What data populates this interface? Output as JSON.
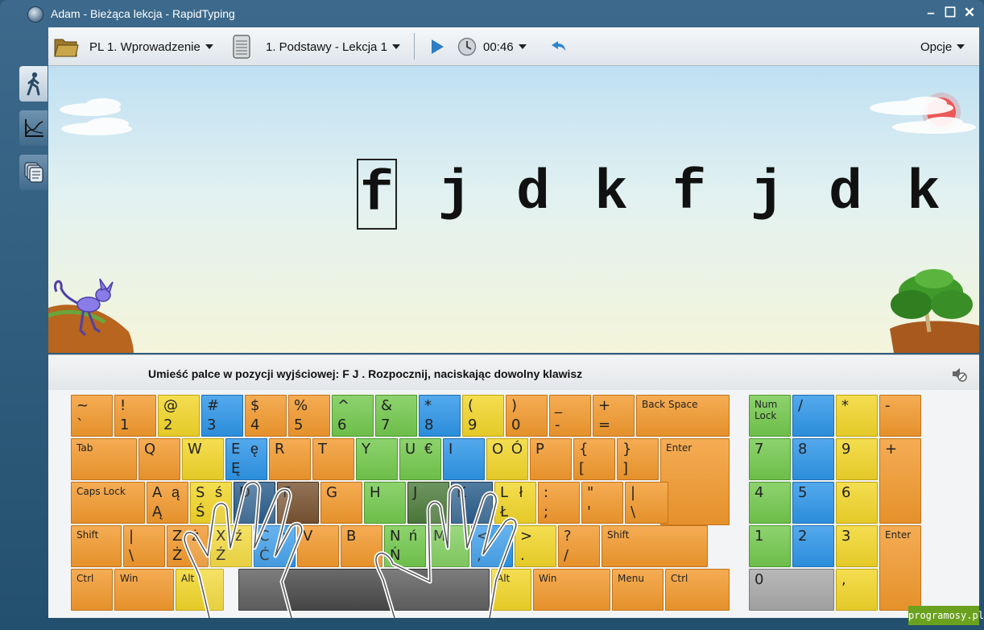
{
  "window": {
    "title": "Adam - Bieżąca lekcja - RapidTyping",
    "minimize": "–",
    "maximize": "☐",
    "close": "✕"
  },
  "toolbar": {
    "course": "PL 1. Wprowadzenie",
    "lesson": "1. Podstawy - Lekcja 1",
    "timer": "00:46",
    "options": "Opcje"
  },
  "sidebar": {
    "items": [
      {
        "name": "lesson-icon",
        "active": true
      },
      {
        "name": "statistics-icon",
        "active": false
      },
      {
        "name": "library-icon",
        "active": false
      }
    ]
  },
  "exercise": {
    "letters": [
      "f",
      "j",
      "d",
      "k",
      "f",
      "j",
      "d",
      "k"
    ],
    "current_index": 0
  },
  "instruction": "Umieść palce w pozycji wyjściowej:  F  J .  Rozpocznij, naciskając dowolny klawisz",
  "keyboard": {
    "main": [
      {
        "t": "~",
        "b": "`",
        "c": "orange"
      },
      {
        "t": "!",
        "b": "1",
        "c": "orange"
      },
      {
        "t": "@",
        "b": "2",
        "c": "yellow"
      },
      {
        "t": "#",
        "b": "3",
        "c": "blue"
      },
      {
        "t": "$",
        "b": "4",
        "c": "orange"
      },
      {
        "t": "%",
        "b": "5",
        "c": "orange"
      },
      {
        "t": "^",
        "b": "6",
        "c": "green"
      },
      {
        "t": "&",
        "b": "7",
        "c": "green"
      },
      {
        "t": "*",
        "b": "8",
        "c": "blue"
      },
      {
        "t": "(",
        "b": "9",
        "c": "yellow"
      },
      {
        "t": ")",
        "b": "0",
        "c": "orange"
      },
      {
        "t": "_",
        "b": "-",
        "c": "orange"
      },
      {
        "t": "+",
        "b": "=",
        "c": "orange"
      },
      {
        "t": "Back Space",
        "b": "",
        "c": "orange",
        "small": true
      },
      {
        "t": "Tab",
        "b": "",
        "c": "orange",
        "small": true
      },
      {
        "t": "Q",
        "b": "",
        "c": "orange"
      },
      {
        "t": "W",
        "b": "",
        "c": "yellow"
      },
      {
        "t": "E",
        "b": "Ę",
        "r": "ę",
        "c": "blue"
      },
      {
        "t": "R",
        "b": "",
        "c": "orange"
      },
      {
        "t": "T",
        "b": "",
        "c": "orange"
      },
      {
        "t": "Y",
        "b": "",
        "c": "green"
      },
      {
        "t": "U",
        "b": "",
        "r": "€",
        "c": "green"
      },
      {
        "t": "I",
        "b": "",
        "c": "blue"
      },
      {
        "t": "O",
        "b": "",
        "r": "Ó",
        "c": "yellow"
      },
      {
        "t": "P",
        "b": "",
        "c": "orange"
      },
      {
        "t": "{",
        "b": "[",
        "c": "orange"
      },
      {
        "t": "}",
        "b": "]",
        "c": "orange"
      },
      {
        "t": "Enter",
        "b": "",
        "c": "orange",
        "small": true
      },
      {
        "t": "Caps Lock",
        "b": "",
        "c": "orange",
        "small": true
      },
      {
        "t": "A",
        "b": "Ą",
        "r": "ą",
        "c": "orange"
      },
      {
        "t": "S",
        "b": "Ś",
        "r": "ś",
        "c": "yellow"
      },
      {
        "t": "D",
        "b": "",
        "c": "pressedblue"
      },
      {
        "t": "F",
        "b": "",
        "c": "pressedorange"
      },
      {
        "t": "G",
        "b": "",
        "c": "orange"
      },
      {
        "t": "H",
        "b": "",
        "c": "green"
      },
      {
        "t": "J",
        "b": "",
        "c": "pressedgreen"
      },
      {
        "t": "K",
        "b": "",
        "c": "pressedblue"
      },
      {
        "t": "L",
        "b": "Ł",
        "r": "ł",
        "c": "yellow"
      },
      {
        "t": ":",
        "b": ";",
        "c": "orange"
      },
      {
        "t": "\"",
        "b": "'",
        "c": "orange"
      },
      {
        "t": "|",
        "b": "\\",
        "c": "orange"
      },
      {
        "t": "Shift",
        "b": "",
        "c": "orange",
        "small": true
      },
      {
        "t": "|",
        "b": "\\",
        "c": "orange"
      },
      {
        "t": "Z",
        "b": "Ż",
        "r": "ż",
        "c": "orange"
      },
      {
        "t": "X",
        "b": "Ź",
        "r": "ź",
        "c": "yellow"
      },
      {
        "t": "C",
        "b": "Ć",
        "r": "ć",
        "c": "blue"
      },
      {
        "t": "V",
        "b": "",
        "c": "orange"
      },
      {
        "t": "B",
        "b": "",
        "c": "orange"
      },
      {
        "t": "N",
        "b": "Ń",
        "r": "ń",
        "c": "green"
      },
      {
        "t": "M",
        "b": "",
        "c": "green"
      },
      {
        "t": "<",
        "b": ",",
        "c": "blue"
      },
      {
        "t": ">",
        "b": ".",
        "c": "yellow"
      },
      {
        "t": "?",
        "b": "/",
        "c": "orange"
      },
      {
        "t": "Shift",
        "b": "",
        "c": "orange",
        "small": true
      },
      {
        "t": "Ctrl",
        "b": "",
        "c": "orange",
        "small": true
      },
      {
        "t": "Win",
        "b": "",
        "c": "orange",
        "small": true
      },
      {
        "t": "Alt",
        "b": "",
        "c": "yellow",
        "small": true
      },
      {
        "t": "",
        "b": "",
        "c": "dark"
      },
      {
        "t": "Alt",
        "b": "",
        "c": "yellow",
        "small": true
      },
      {
        "t": "Win",
        "b": "",
        "c": "orange",
        "small": true
      },
      {
        "t": "Menu",
        "b": "",
        "c": "orange",
        "small": true
      },
      {
        "t": "Ctrl",
        "b": "",
        "c": "orange",
        "small": true
      }
    ],
    "numpad": [
      {
        "t": "Num Lock",
        "c": "green",
        "small": true
      },
      {
        "t": "/",
        "c": "blue"
      },
      {
        "t": "*",
        "c": "yellow"
      },
      {
        "t": "-",
        "c": "orange"
      },
      {
        "t": "7",
        "c": "green"
      },
      {
        "t": "8",
        "c": "blue"
      },
      {
        "t": "9",
        "c": "yellow"
      },
      {
        "t": "+",
        "c": "orange"
      },
      {
        "t": "4",
        "c": "green"
      },
      {
        "t": "5",
        "c": "blue"
      },
      {
        "t": "6",
        "c": "yellow"
      },
      {
        "t": "1",
        "c": "green"
      },
      {
        "t": "2",
        "c": "blue"
      },
      {
        "t": "3",
        "c": "yellow"
      },
      {
        "t": "Enter",
        "c": "orange",
        "small": true
      },
      {
        "t": "0",
        "c": "gray"
      },
      {
        "t": ",",
        "c": "yellow"
      }
    ]
  },
  "watermark": "programosy.pl"
}
